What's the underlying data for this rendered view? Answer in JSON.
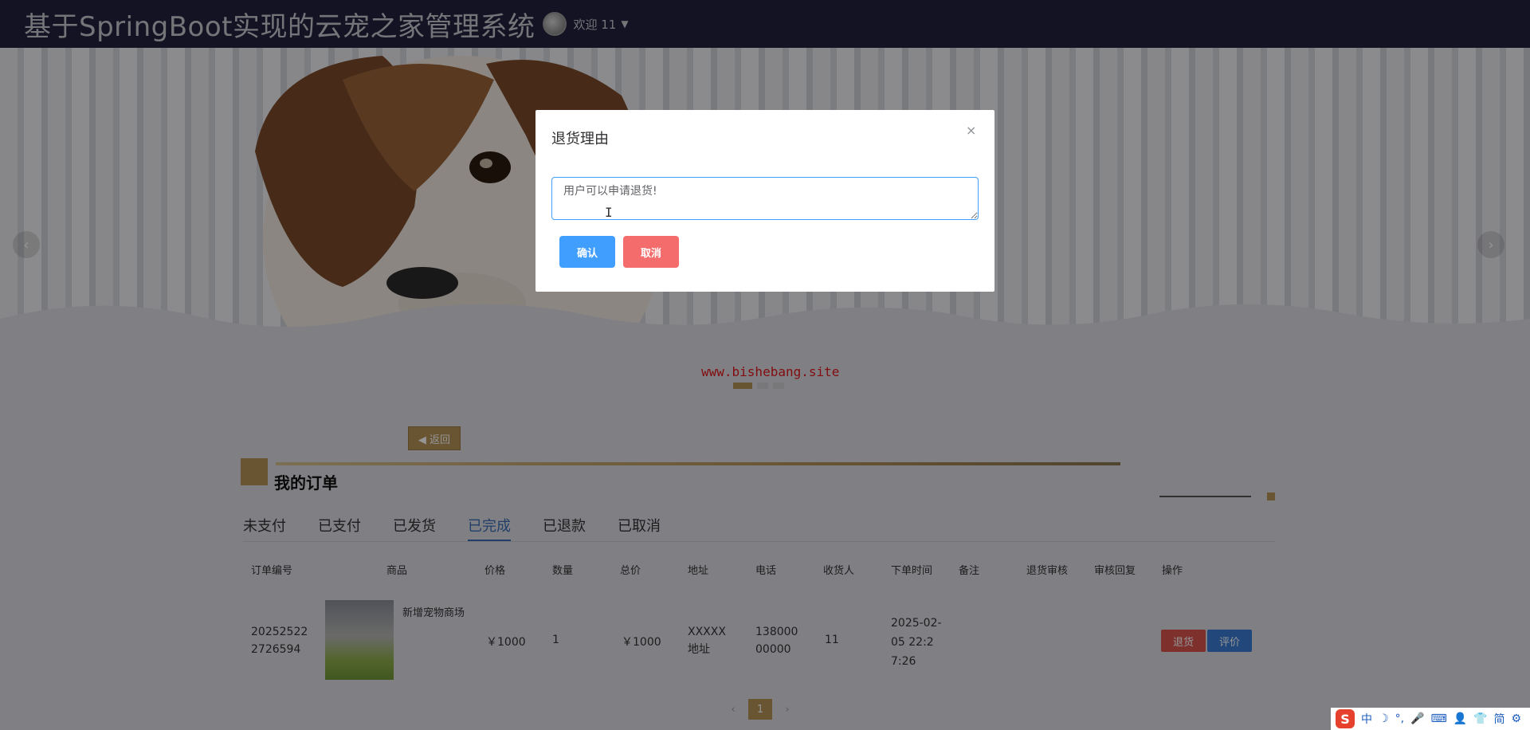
{
  "header": {
    "title": "基于SpringBoot实现的云宠之家管理系统",
    "welcome": "欢迎 11",
    "caret": "▼"
  },
  "banner": {
    "watermark": "www.bishebang.site",
    "prev": "‹",
    "next": "›",
    "dots": 3,
    "active_dot": 0
  },
  "content": {
    "back_label": "◀ 返回",
    "page_title": "我的订单",
    "tabs": [
      {
        "label": "未支付",
        "active": false
      },
      {
        "label": "已支付",
        "active": false
      },
      {
        "label": "已发货",
        "active": false
      },
      {
        "label": "已完成",
        "active": true
      },
      {
        "label": "已退款",
        "active": false
      },
      {
        "label": "已取消",
        "active": false
      }
    ],
    "table": {
      "headers": [
        "订单编号",
        "商品",
        "价格",
        "数量",
        "总价",
        "地址",
        "电话",
        "收货人",
        "下单时间",
        "备注",
        "退货审核",
        "审核回复",
        "操作"
      ],
      "row": {
        "order_no": "202525222726594",
        "product": "新增宠物商场",
        "price": "￥1000",
        "quantity": "1",
        "total": "￥1000",
        "address": "XXXXX地址",
        "phone": "13800000000",
        "receiver": "11",
        "time": "2025-02-05 22:27:26",
        "remark": "",
        "return_audit": "",
        "audit_reply": "",
        "actions": {
          "return": "退货",
          "review": "评价"
        }
      }
    },
    "pager": {
      "prev": "‹",
      "page": "1",
      "next": "›"
    }
  },
  "dialog": {
    "title": "退货理由",
    "close": "×",
    "input_value": "用户可以申请退货!",
    "confirm": "确认",
    "cancel": "取消",
    "cursor": "I"
  },
  "tray": {
    "logo": "S",
    "items": [
      "中",
      "☽",
      "°,",
      "🎤",
      "⌨",
      "👤",
      "👕",
      "简",
      "⚙"
    ]
  },
  "colors": {
    "accent": "#b59357",
    "primary": "#409eff",
    "danger": "#f56c6c",
    "header_bg": "#21223f"
  }
}
